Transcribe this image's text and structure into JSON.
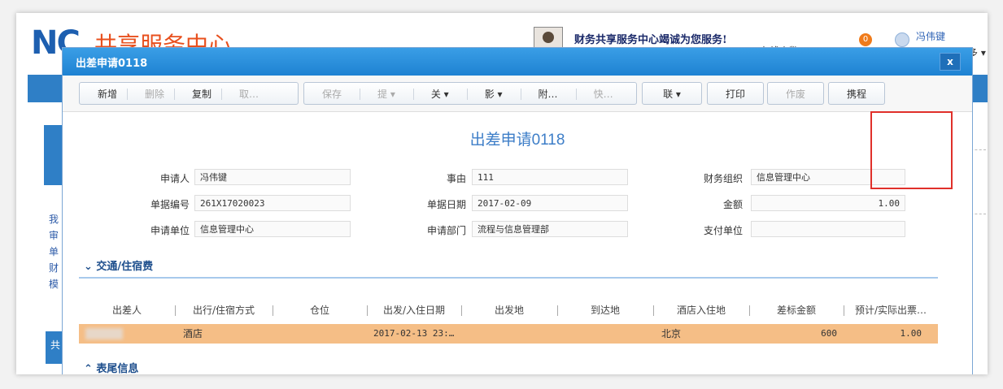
{
  "header": {
    "logo": "NC",
    "logo_sub": "共享服务中心",
    "slogan": "财务共享服务中心竭诚为您服务!",
    "online_label": "在线人数：0",
    "badge_count": "0",
    "user_name": "冯伟键",
    "more_label": "更多 ▾"
  },
  "background": {
    "left_list": [
      "我",
      "审",
      "单",
      "财",
      "模"
    ],
    "left_box": "共",
    "dot_colors": [
      "#2b8fe0",
      "#8cc63e",
      "#f07b1a",
      "#2b8fe0",
      "#8cc63e"
    ]
  },
  "modal": {
    "title": "出差申请0118",
    "close_label": "x",
    "toolbar": {
      "group1": [
        {
          "label": "新增",
          "disabled": false
        },
        {
          "label": "删除",
          "disabled": true
        },
        {
          "label": "复制",
          "disabled": false
        },
        {
          "label": "取…",
          "disabled": true
        }
      ],
      "group2": [
        {
          "label": "保存",
          "disabled": true
        },
        {
          "label": "提 ▾",
          "disabled": true
        },
        {
          "label": "关 ▾",
          "disabled": false
        },
        {
          "label": "影 ▾",
          "disabled": false
        },
        {
          "label": "附…",
          "disabled": false
        },
        {
          "label": "快…",
          "disabled": true
        }
      ],
      "link_label": "联 ▾",
      "print_label": "打印",
      "void_label": "作废",
      "trip_label": "携程"
    },
    "form_title": "出差申请0118",
    "fields": {
      "applicant_label": "申请人",
      "applicant": "冯伟键",
      "reason_label": "事由",
      "reason": "111",
      "org_label": "财务组织",
      "org": "信息管理中心",
      "docno_label": "单据编号",
      "docno": "261X17020023",
      "docdate_label": "单据日期",
      "docdate": "2017-02-09",
      "amount_label": "金额",
      "amount": "1.00",
      "unit_label": "申请单位",
      "unit": "信息管理中心",
      "dept_label": "申请部门",
      "dept": "流程与信息管理部",
      "pay_label": "支付单位",
      "pay": ""
    },
    "section1": "交通/住宿费",
    "section2": "表尾信息",
    "table": {
      "headers": [
        "出差人",
        "出行/住宿方式",
        "仓位",
        "出发/入住日期",
        "出发地",
        "到达地",
        "酒店入住地",
        "差标金额",
        "预计/实际出票…"
      ],
      "rows": [
        {
          "traveler": "",
          "mode": "酒店",
          "seat": "",
          "date": "2017-02-13 23:…",
          "from": "",
          "to": "",
          "hotel_city": "北京",
          "standard": "600",
          "estimate": "1.00"
        }
      ]
    }
  }
}
